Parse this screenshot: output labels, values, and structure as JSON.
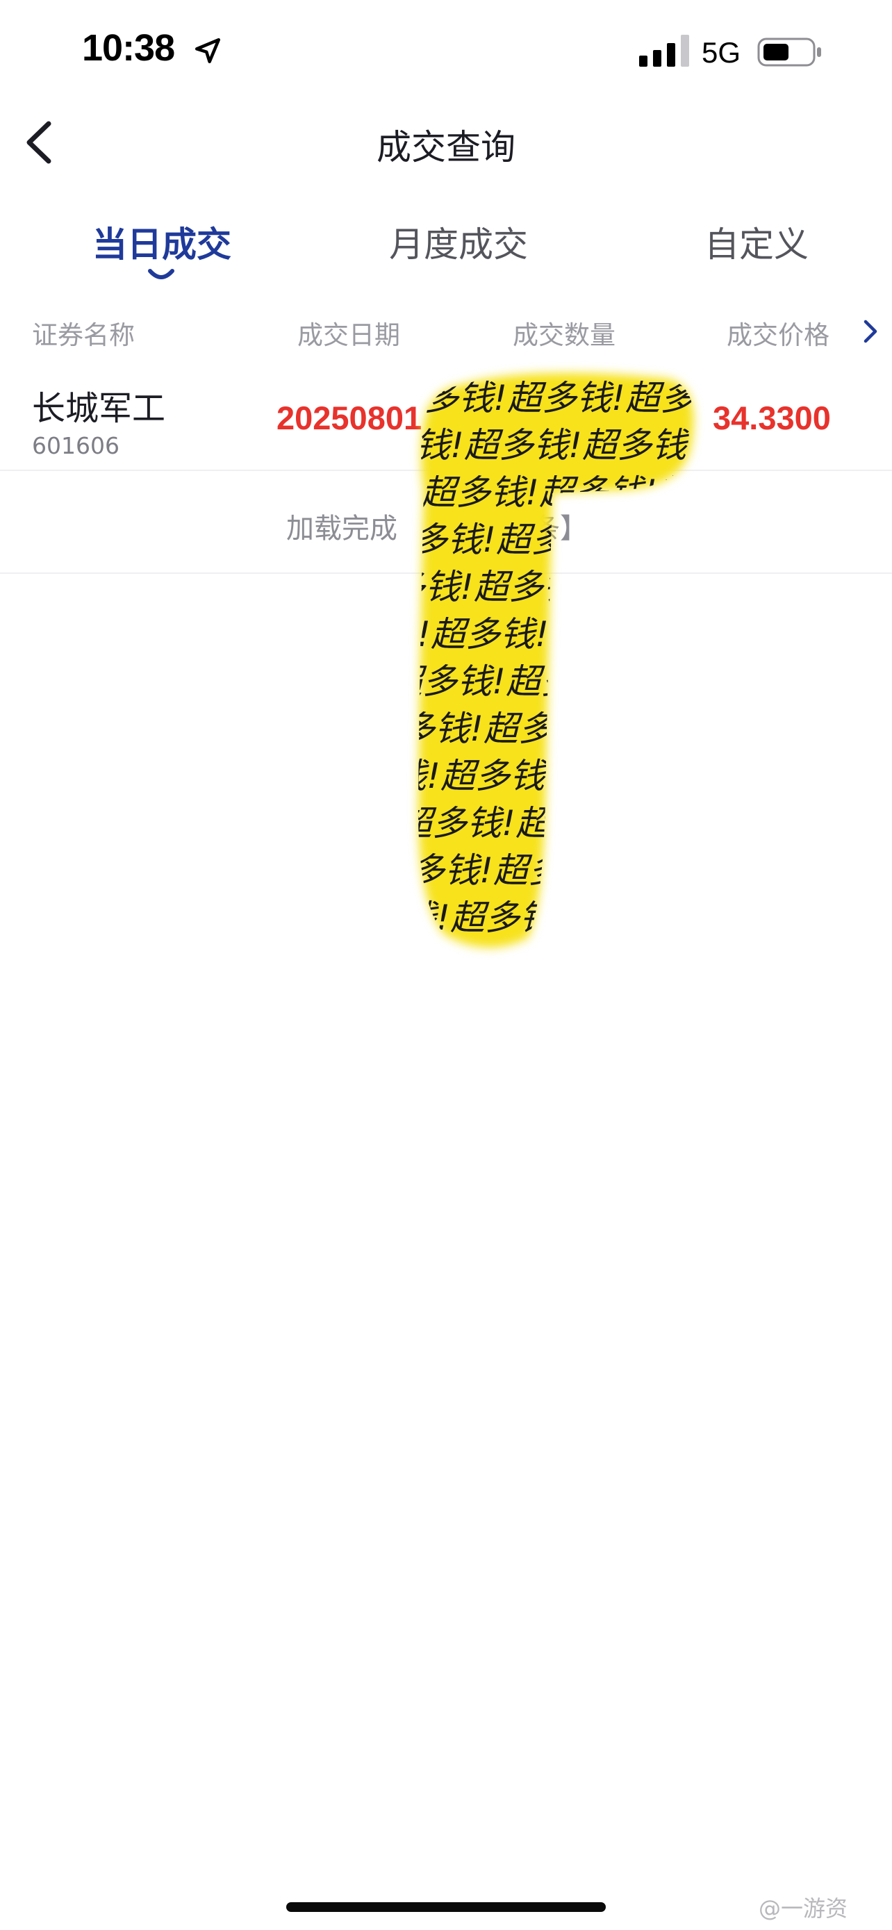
{
  "status_bar": {
    "time": "10:38",
    "network": "5G",
    "icons": [
      "location-arrow-icon",
      "signal-bars-icon",
      "battery-icon"
    ]
  },
  "nav": {
    "title": "成交查询",
    "back_icon": "chevron-left-icon"
  },
  "tabs": [
    {
      "label": "当日成交",
      "active": true
    },
    {
      "label": "月度成交",
      "active": false
    },
    {
      "label": "自定义",
      "active": false
    }
  ],
  "table": {
    "headers": [
      "证券名称",
      "成交日期",
      "成交数量",
      "成交价格"
    ],
    "rows": [
      {
        "name": "长城军工",
        "code": "601606",
        "date": "20250801",
        "quantity": "",
        "price": "34.3300"
      }
    ],
    "load_text": "加载完成",
    "load_tail": "条】"
  },
  "redaction": {
    "text": "超多钱!",
    "color": "#f7e21c"
  },
  "watermark": "@一游资",
  "colors": {
    "accent": "#1f3a9a",
    "price_red": "#e8322c",
    "muted": "#9a9aa2"
  }
}
